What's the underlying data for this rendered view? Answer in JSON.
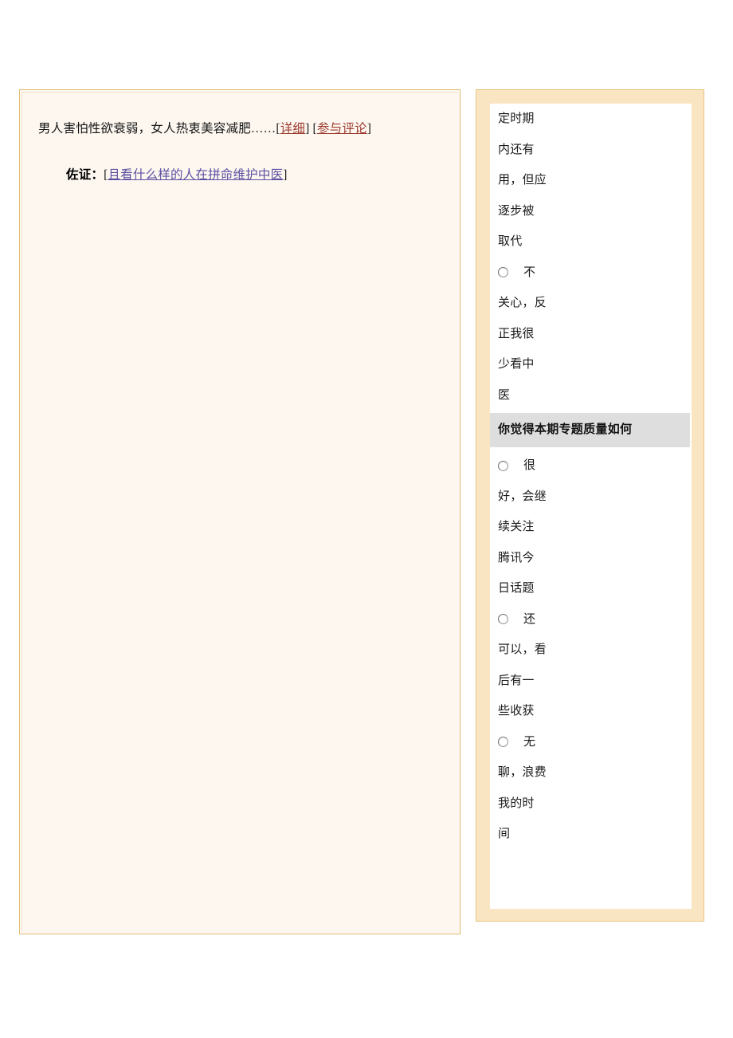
{
  "page": {
    "background": "#ffffff",
    "accent_border": "#e9c57f",
    "panel_bg_left": "#fdf7f0",
    "panel_bg_right": "#fae5c3"
  },
  "article": {
    "line1": {
      "text": "男人害怕性欲衰弱，女人热衷美容减肥……",
      "links": [
        {
          "open_bracket": "[",
          "label": "详细",
          "close_bracket": "]",
          "color": "#9c3b2e"
        },
        {
          "open_bracket": "[",
          "label": "参与评论",
          "close_bracket": "]",
          "color": "#9c3b2e"
        }
      ]
    },
    "line2": {
      "label": "佐证：",
      "open_bracket": "[",
      "link_label": "且看什么样的人在拼命维护中医",
      "close_bracket": "]",
      "link_color": "#5b4fa0"
    }
  },
  "sidebar": {
    "poll_previous": {
      "continuation_lines": [
        "定时期",
        "内还有",
        "用，但应",
        "逐步被",
        "取代"
      ],
      "last_option": {
        "icon": "radio-unchecked-icon",
        "first_line": "不",
        "wrapped_lines": [
          "关心，反",
          "正我很",
          "少看中",
          "医"
        ]
      }
    },
    "poll_current": {
      "header": "你觉得本期专题质量如何",
      "header_bg": "#dedede",
      "options": [
        {
          "icon": "radio-unchecked-icon",
          "first_line": "很",
          "wrapped_lines": [
            "好，会继",
            "续关注",
            "腾讯今",
            "日话题"
          ]
        },
        {
          "icon": "radio-unchecked-icon",
          "first_line": "还",
          "wrapped_lines": [
            "可以，看",
            "后有一",
            "些收获"
          ]
        },
        {
          "icon": "radio-unchecked-icon",
          "first_line": "无",
          "wrapped_lines": [
            "聊，浪费",
            "我的时",
            "间"
          ]
        }
      ]
    }
  }
}
